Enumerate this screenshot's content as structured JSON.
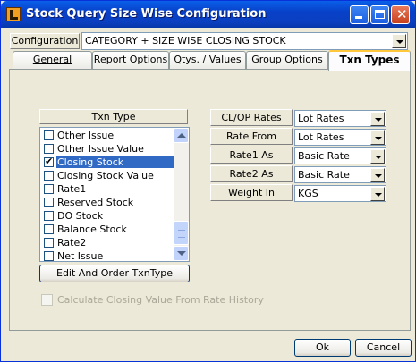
{
  "window": {
    "title": "Stock Query Size Wise Configuration"
  },
  "configuration": {
    "label": "Configuration",
    "value": "CATEGORY + SIZE WISE CLOSING STOCK"
  },
  "tabs": [
    {
      "label": "General",
      "active": false
    },
    {
      "label": "Report Options",
      "active": false
    },
    {
      "label": "Qtys. / Values",
      "active": false
    },
    {
      "label": "Group Options",
      "active": false
    },
    {
      "label": "Txn Types",
      "active": true
    }
  ],
  "txn": {
    "header": "Txn Type",
    "items": [
      {
        "label": "Other Issue",
        "checked": false
      },
      {
        "label": "Other Issue Value",
        "checked": false
      },
      {
        "label": "Closing Stock",
        "checked": true,
        "selected": true
      },
      {
        "label": "Closing Stock Value",
        "checked": false
      },
      {
        "label": "Rate1",
        "checked": false
      },
      {
        "label": "Reserved Stock",
        "checked": false
      },
      {
        "label": "DO Stock",
        "checked": false
      },
      {
        "label": "Balance Stock",
        "checked": false
      },
      {
        "label": "Rate2",
        "checked": false
      },
      {
        "label": "Net Issue",
        "checked": false
      }
    ],
    "edit_button": "Edit And Order TxnType",
    "calc_checkbox": "Calculate Closing Value From Rate History"
  },
  "rates": [
    {
      "label": "CL/OP Rates",
      "value": "Lot Rates"
    },
    {
      "label": "Rate From",
      "value": "Lot Rates"
    },
    {
      "label": "Rate1 As",
      "value": "Basic Rate"
    },
    {
      "label": "Rate2 As",
      "value": "Basic Rate"
    },
    {
      "label": "Weight In",
      "value": "KGS"
    }
  ],
  "buttons": {
    "ok": "Ok",
    "cancel": "Cancel"
  },
  "colors": {
    "titlebar": "#0a5fe8",
    "selection": "#316ac5",
    "active_tab_accent": "#ffc83c"
  }
}
